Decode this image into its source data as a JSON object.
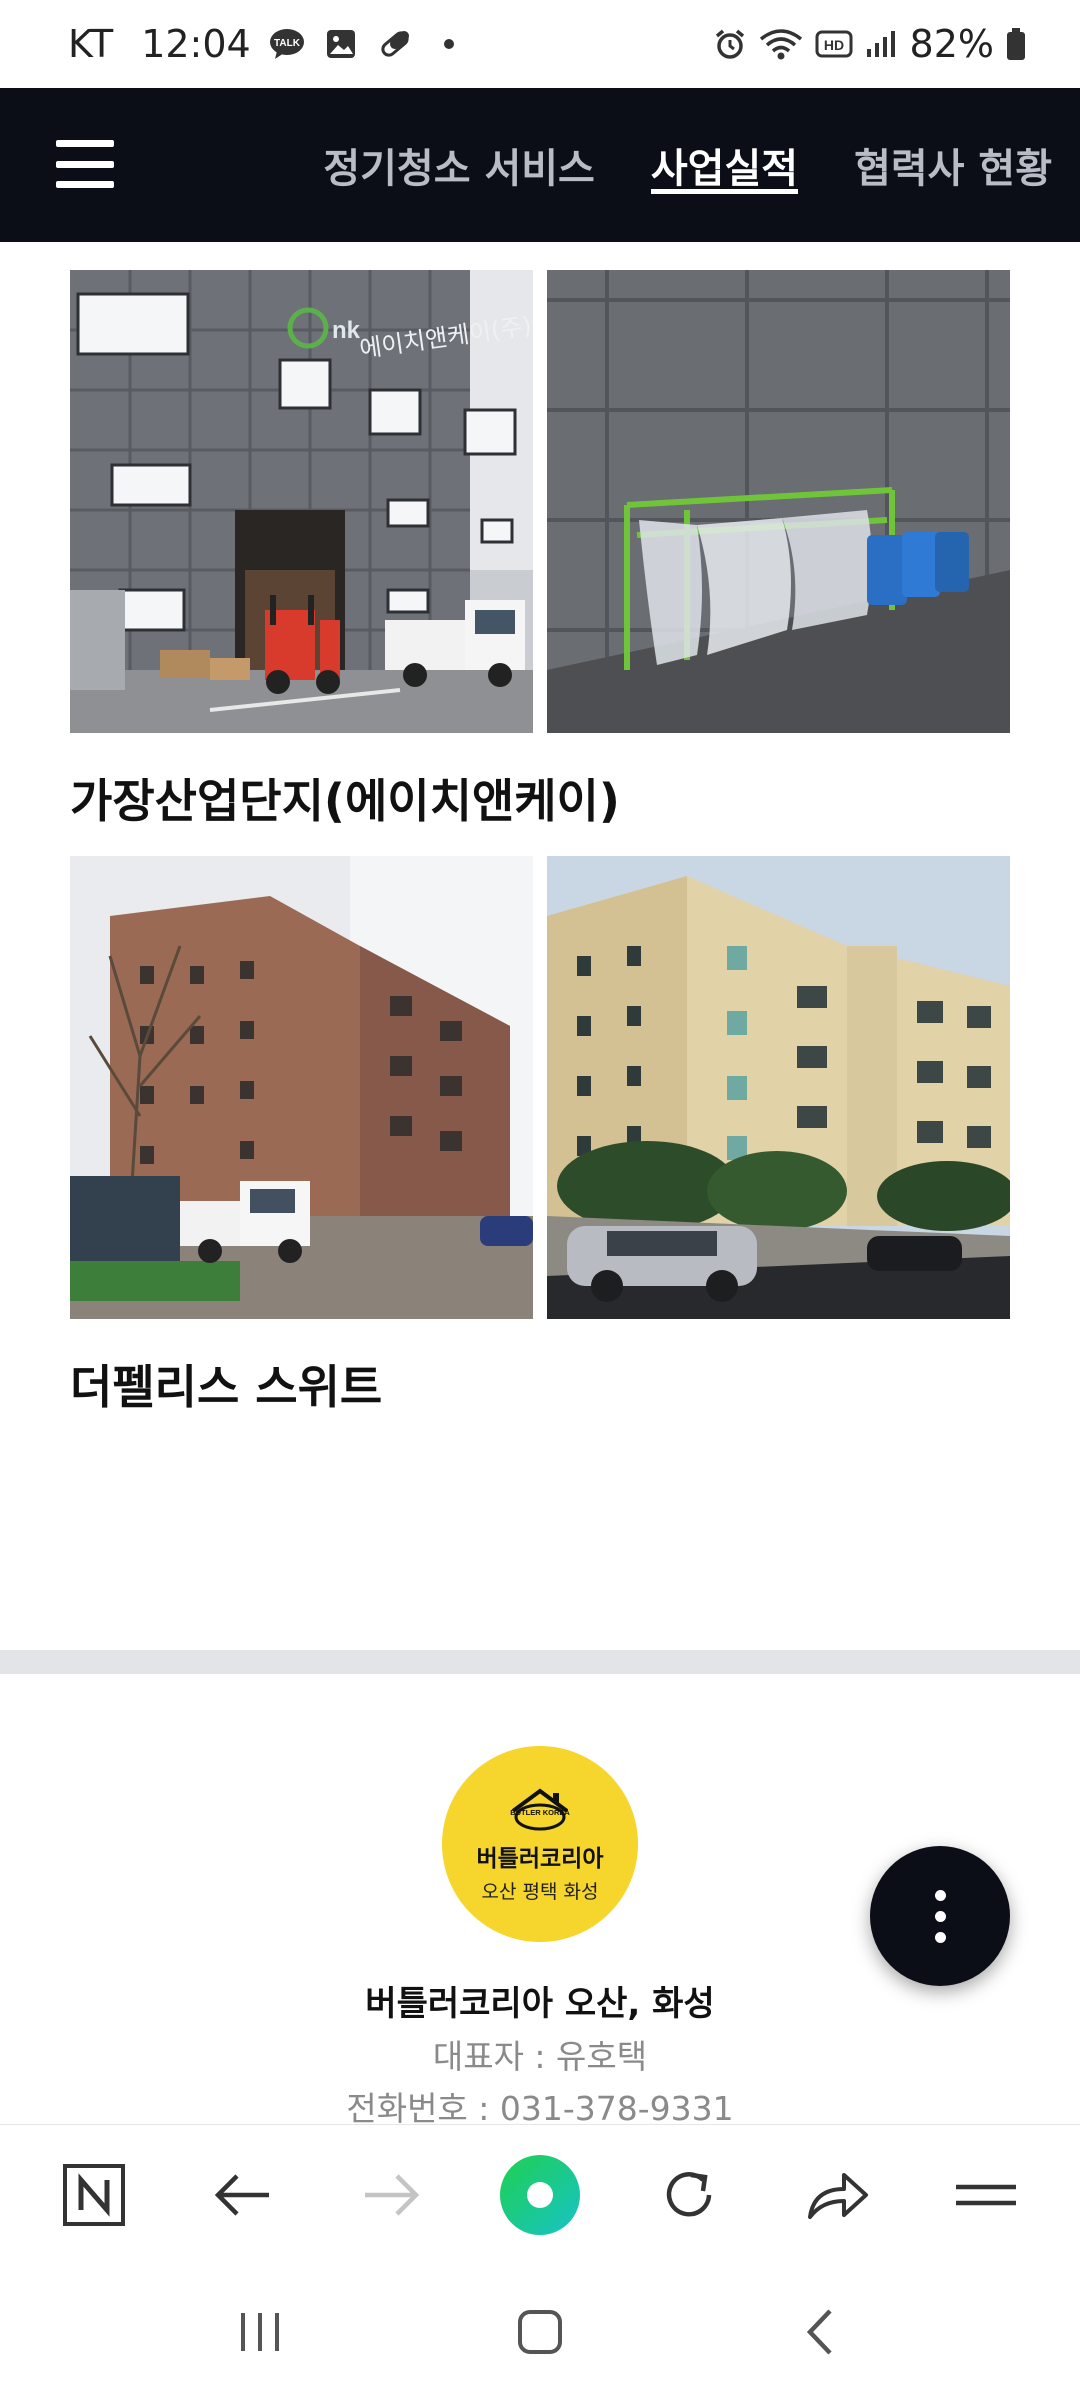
{
  "status_bar": {
    "carrier": "KT",
    "time": "12:04",
    "notification_icons": [
      "talk-icon",
      "gallery-icon",
      "pill-icon",
      "dot-icon"
    ],
    "system_icons": [
      "alarm-icon",
      "wifi-icon",
      "hd-icon",
      "signal-icon",
      "battery-icon"
    ],
    "battery": "82%"
  },
  "nav": {
    "tabs": [
      {
        "label": "정기청소 서비스",
        "active": false
      },
      {
        "label": "사업실적",
        "active": true
      },
      {
        "label": "협력사 현황",
        "active": false
      }
    ]
  },
  "projects": [
    {
      "title": "가장산업단지(에이치앤케이)",
      "sign_text": "에이치앤케이(주)",
      "logo_text": "nk"
    },
    {
      "title": "더펠리스 스위트"
    }
  ],
  "footer": {
    "logo": {
      "mark": "BUTLER KOREA",
      "brand": "버틀러코리아",
      "area": "오산 평택 화성"
    },
    "company": "버틀러코리아 오산, 화성",
    "ceo": "대표자 : 유호택",
    "phone": "전화번호 : 031-378-9331"
  },
  "colors": {
    "nav_bg": "#0b0d17",
    "logo_yellow": "#f6d52d",
    "browser_green": "#2fd07a",
    "divider": "#e2e4e8"
  }
}
